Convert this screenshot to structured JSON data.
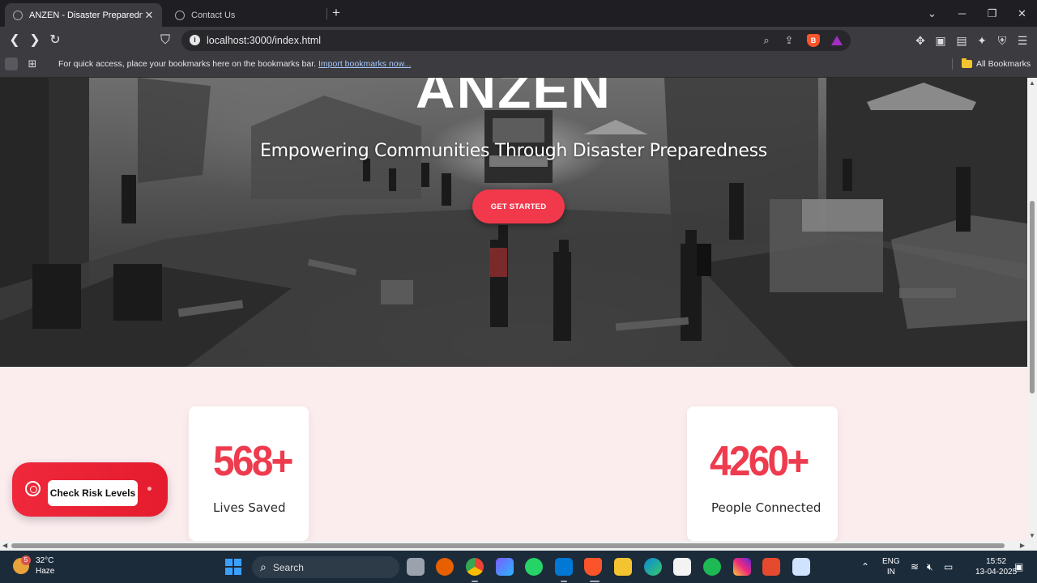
{
  "browser": {
    "tabs": [
      {
        "title": "ANZEN - Disaster Preparedness",
        "active": true
      },
      {
        "title": "Contact Us",
        "active": false
      }
    ],
    "url": "localhost:3000/index.html",
    "bookmarks_bar": {
      "message": "For quick access, place your bookmarks here on the bookmarks bar.",
      "import_link": "Import bookmarks now...",
      "all_bookmarks": "All Bookmarks"
    }
  },
  "hero": {
    "brand": "ANZEN",
    "tagline": "Empowering Communities Through Disaster Preparedness",
    "cta_label": "GET STARTED"
  },
  "stats": [
    {
      "value": "568+",
      "label": "Lives Saved"
    },
    {
      "value": "4260+",
      "label": "People Connected"
    }
  ],
  "risk_widget": {
    "label": "Check Risk Levels"
  },
  "taskbar": {
    "weather_temp": "32°C",
    "weather_desc": "Haze",
    "weather_badge": "5",
    "search_label": "Search",
    "lang_line1": "ENG",
    "lang_line2": "IN",
    "time": "15:52",
    "date": "13-04-2025"
  },
  "colors": {
    "accent": "#f2394c",
    "stat_number": "#ee3b4e",
    "stats_bg": "#fbecee"
  }
}
